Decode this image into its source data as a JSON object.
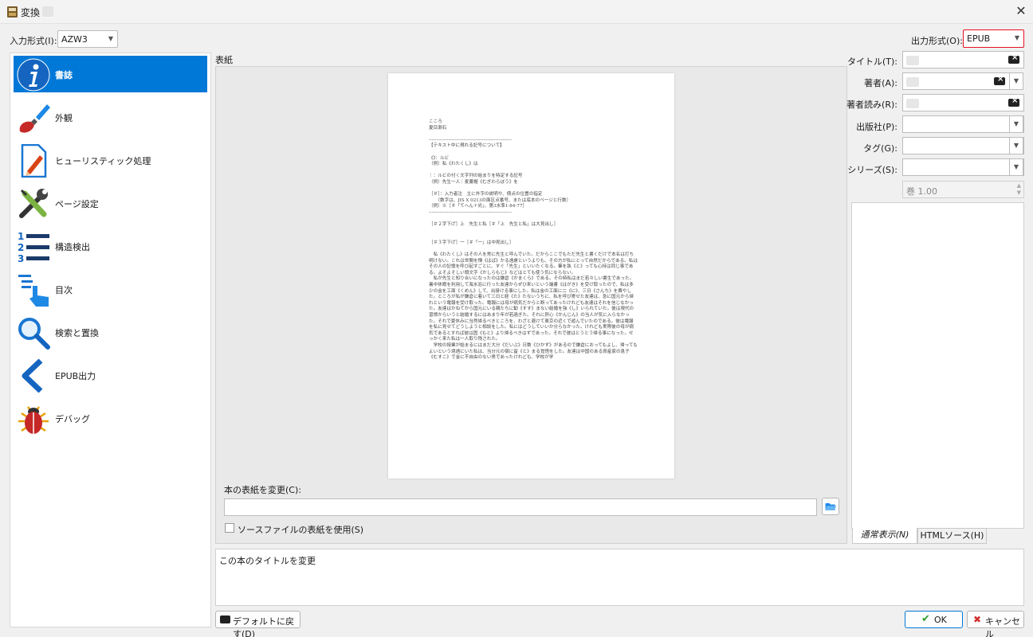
{
  "window": {
    "title": "変換"
  },
  "input_format": {
    "label": "入力形式(I):",
    "value": "AZW3"
  },
  "output_format": {
    "label": "出力形式(O):",
    "value": "EPUB"
  },
  "sidebar": {
    "items": [
      {
        "label": "書誌",
        "icon": "info-icon"
      },
      {
        "label": "外観",
        "icon": "paintbrush-icon"
      },
      {
        "label": "ヒューリスティック処理",
        "icon": "document-edit-icon"
      },
      {
        "label": "ページ設定",
        "icon": "tools-icon"
      },
      {
        "label": "構造検出",
        "icon": "numbered-list-icon"
      },
      {
        "label": "目次",
        "icon": "toc-pointer-icon"
      },
      {
        "label": "検索と置換",
        "icon": "search-icon"
      },
      {
        "label": "EPUB出力",
        "icon": "chevron-left-icon"
      },
      {
        "label": "デバッグ",
        "icon": "bug-icon"
      }
    ]
  },
  "cover": {
    "section_label": "表紙",
    "page_text": "こころ\n夏目漱石\n\n-------------------------------------------------------\n【テキスト中に現れる記号について】\n\n《》：ルビ\n（例）私《わたくし》は\n\n｜：ルビの付く文字列の始まりを特定する記号\n（例）先生一人｜麦藁帽《むぎわらぼう》を\n\n［＃］：入力者注　主に外字の説明や、傍点の位置の指定\n　　（数字は、JIS X 0213の面区点番号、または底本のページと行数）\n（例）※［＃「てへん＋劣」、第3水準1-84-77］\n-------------------------------------------------------\n\n［＃２字下げ］上　先生と私［＃「上　先生と私」は大見出し］\n\n\n［＃３字下げ］一［＃「一」は中見出し］\n\n　私《わたくし》はその人を常に先生と呼んでいた。だからここでもただ先生と書くだけで本名は打ち明けない。これは世間を憚《はば》かる遠慮というよりも、その方が私にとって自然だからである。私はその人の記憶を呼び起すごとに、すぐ「先生」といいたくなる。筆を執《と》っても心持は同じ事である。よそよそしい頭文字《かしらもじ》などはとても使う気にならない。\n　私が先生と知り合いになったのは鎌倉《かまくら》である。その時私はまだ若々しい書生であった。暑中休暇を利用して海水浴に行った友達からぜひ来いという端書《はがき》を受け取ったので、私は多少の金を工面《くめん》して、出掛ける事にした。私は金の工面に二《に》、三日《さんち》を費やした。ところが私が鎌倉に着いて三日と経《た》たないうちに、私を呼び寄せた友達は、急に国元から帰れという電報を受け取った。電報には母が病気だからと断ってあったけれども友達はそれを信じなかった。友達はかねてから国元にいる親たちに勧《すす》まない結婚を強《し》いられていた。彼は現代の習慣からいうと結婚するにはあまり年が若過ぎた。それに肝心《かんじん》の当人が気に入らなかった。それで夏休みに当然帰るべきところを、わざと避けて東京の近くで遊んでいたのである。彼は電報を私に見せてどうしようと相談をした。私にはどうしていいか分らなかった。けれども実際彼の母が病気であるとすれば彼は固《もと》より帰るべきはずであった。それで彼はとうとう帰る事になった。せっかく来た私は一人取り残された。\n　学校の授業が始まるにはまだ大分《だいぶ》日数《ひかず》があるので鎌倉におってもよし、帰ってもよいという境遇にいた私は、当分元の宿に留《と》まる覚悟をした。友達は中国のある資産家の息子《むすこ》で金に不自由のない男であったけれども、学校が学",
    "change_label": "本の表紙を変更(C):",
    "path_value": "",
    "use_source_label": "ソースファイルの表紙を使用(S)"
  },
  "metadata": {
    "title_label": "タイトル(T):",
    "author_label": "著者(A):",
    "author_sort_label": "著者読み(R):",
    "publisher_label": "出版社(P):",
    "tags_label": "タグ(G):",
    "series_label": "シリーズ(S):",
    "series_index": "巻 1.00"
  },
  "comments_tabs": {
    "normal": "通常表示(N)",
    "html": "HTMLソース(H)"
  },
  "help_text": "この本のタイトルを変更",
  "buttons": {
    "defaults": "デフォルトに戻す(D)",
    "ok": "OK",
    "cancel": "キャンセル"
  },
  "colors": {
    "accent": "#0078d7",
    "output_border": "#e81123"
  }
}
